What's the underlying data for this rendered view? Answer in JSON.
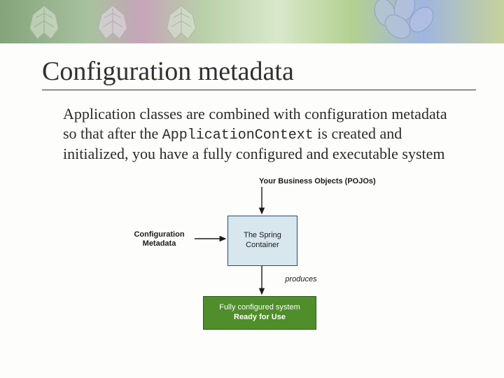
{
  "slide": {
    "title": "Configuration metadata",
    "body_pre": "Application classes are combined with configuration metadata so that after the ",
    "body_code": "ApplicationContext",
    "body_post": " is created and initialized, you have a fully configured and executable system"
  },
  "diagram": {
    "pojos_label": "Your Business Objects (POJOs)",
    "config_label": "Configuration\nMetadata",
    "spring_box": "The Spring\nContainer",
    "produces_label": "produces",
    "ready_line1": "Fully configured system",
    "ready_line2": "Ready for Use"
  }
}
